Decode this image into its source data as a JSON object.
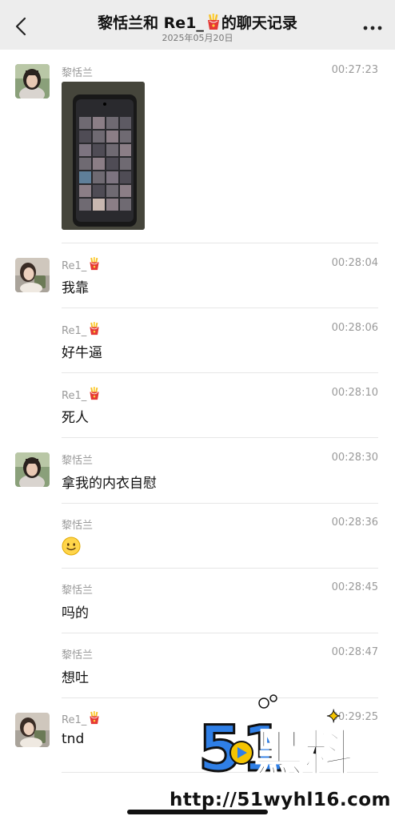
{
  "header": {
    "title_prefix": "黎恬兰和 Re1_",
    "title_suffix": "的聊天记录",
    "date": "2025年05月20日"
  },
  "messages": [
    {
      "sender": "黎恬兰",
      "time": "00:27:23",
      "type": "image",
      "content": ""
    },
    {
      "sender": "Re1_",
      "time": "00:28:04",
      "type": "text",
      "content": "我靠"
    },
    {
      "sender": "Re1_",
      "time": "00:28:06",
      "type": "text",
      "content": "好牛逼"
    },
    {
      "sender": "Re1_",
      "time": "00:28:10",
      "type": "text",
      "content": "死人"
    },
    {
      "sender": "黎恬兰",
      "time": "00:28:30",
      "type": "text",
      "content": "拿我的内衣自慰"
    },
    {
      "sender": "黎恬兰",
      "time": "00:28:36",
      "type": "emoji",
      "content": "smile-emoji"
    },
    {
      "sender": "黎恬兰",
      "time": "00:28:45",
      "type": "text",
      "content": "吗的"
    },
    {
      "sender": "黎恬兰",
      "time": "00:28:47",
      "type": "text",
      "content": "想吐"
    },
    {
      "sender": "Re1_",
      "time": "00:29:25",
      "type": "text",
      "content": "tnd"
    }
  ],
  "watermark": {
    "brand": "51黑料",
    "url": "http://51wyhl16.com"
  },
  "icons": {
    "back": "chevron-left-icon",
    "more": "more-dots-icon",
    "fries": "french-fries-emoji"
  },
  "colors": {
    "header_bg": "#ededed",
    "meta_text": "#9a9a9a",
    "divider": "#e6e6e6",
    "watermark_blue": "#2f7fe6",
    "watermark_yellow": "#f5c400"
  }
}
